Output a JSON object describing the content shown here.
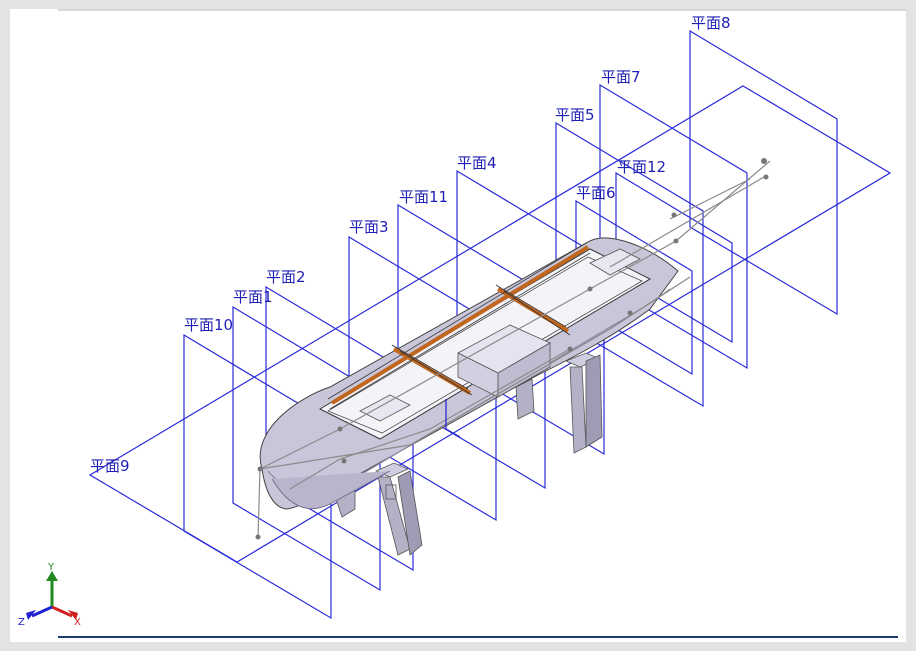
{
  "viewport": {
    "planes": [
      {
        "id": "plane-8",
        "label": "平面8"
      },
      {
        "id": "plane-7",
        "label": "平面7"
      },
      {
        "id": "plane-5",
        "label": "平面5"
      },
      {
        "id": "plane-12",
        "label": "平面12"
      },
      {
        "id": "plane-4",
        "label": "平面4"
      },
      {
        "id": "plane-6",
        "label": "平面6"
      },
      {
        "id": "plane-11",
        "label": "平面11"
      },
      {
        "id": "plane-3",
        "label": "平面3"
      },
      {
        "id": "plane-2",
        "label": "平面2"
      },
      {
        "id": "plane-1",
        "label": "平面1"
      },
      {
        "id": "plane-10",
        "label": "平面10"
      },
      {
        "id": "plane-9",
        "label": "平面9"
      }
    ],
    "triad": {
      "x_label": "X",
      "y_label": "Y",
      "z_label": "Z"
    },
    "colors": {
      "plane_line": "#2b2bdb",
      "plane_label": "#1f1fb3",
      "hull": "#c9c6d9",
      "stand": "#b3b1c6",
      "frame_wood": "#c0661e",
      "triad_x": "#d02020",
      "triad_y": "#208a20",
      "triad_z": "#2020d0"
    }
  }
}
